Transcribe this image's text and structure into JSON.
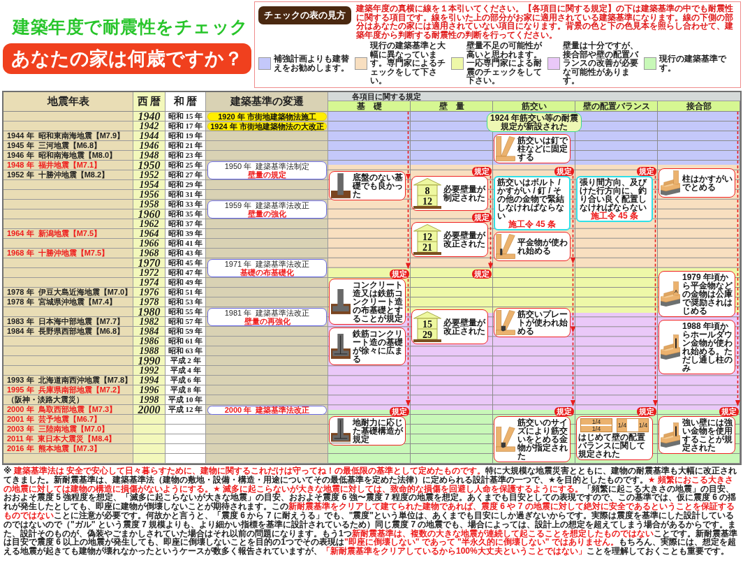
{
  "header": {
    "title": "建築年度で耐震性をチェック",
    "subtitle": "あなたの家は何歳ですか？"
  },
  "legend": {
    "heading": "チェックの表の見方",
    "instructions": "建築年度の真横に線を１本引いてください。【各項目に関する規定】の下は建築基準の中でも耐震性に関する項目です。線を引いた上の部分がお家に適用されている建築基準になります。線の下側の部分はあなたの家には適用されていない項目になります。背景の色と下の色見本を照らし合わせて、建築年度から判断する耐震性の判断を行ってください。",
    "items": [
      {
        "color": "#c4c8fa",
        "text": "補強計画よりも建替えをお勧めします。"
      },
      {
        "color": "#f8dfc0",
        "text": "現行の建築基準と大幅に異なっています。専門家によるチェックをして下さい。"
      },
      {
        "color": "#eef8a8",
        "text": "壁量不足の可能性が高いと思われます。一応専門家による耐震のチェックをして下さい。"
      },
      {
        "color": "#eac8f8",
        "text": "壁量は十分ですが、接合部や壁の配置バランスの改善が必要な可能性があります。"
      },
      {
        "color": "#c8f8b8",
        "text": "現行の建築基準です。"
      }
    ]
  },
  "table": {
    "headers": {
      "events": "地震年表",
      "western": "西 暦",
      "japanese": "和 暦",
      "standards": "建築基準の変遷"
    },
    "rows": [
      {
        "year": "1940",
        "decade": true,
        "era": "昭和 15 年"
      },
      {
        "year": "1942",
        "decade": false,
        "era": "昭和 17 年"
      },
      {
        "event": "1944 年  昭和東南海地震【M7.9】",
        "highlighted": false,
        "year": "1944",
        "decade": false,
        "era": "昭和 19 年"
      },
      {
        "event": "1945 年  三河地震【M6.8】",
        "highlighted": false,
        "year": "1946",
        "decade": false,
        "era": "昭和 21 年"
      },
      {
        "event": "1946 年  昭和南海地震【M8.0】",
        "highlighted": false,
        "year": "1948",
        "decade": false,
        "era": "昭和 23 年"
      },
      {
        "event": "1948 年  福井地震【M7.1】",
        "highlighted": true,
        "year": "1950",
        "decade": true,
        "era": "昭和 25 年"
      },
      {
        "event": "1952 年  十勝沖地震【M8.2】",
        "highlighted": false,
        "year": "1952",
        "decade": false,
        "era": "昭和 27 年"
      },
      {
        "year": "1954",
        "decade": false,
        "era": "昭和 29 年"
      },
      {
        "year": "1956",
        "decade": false,
        "era": "昭和 31 年"
      },
      {
        "year": "1958",
        "decade": false,
        "era": "昭和 33 年"
      },
      {
        "year": "1960",
        "decade": true,
        "era": "昭和 35 年"
      },
      {
        "year": "1962",
        "decade": false,
        "era": "昭和 37 年"
      },
      {
        "event": "1964 年  新潟地震【M7.5】",
        "highlighted": true,
        "year": "1964",
        "decade": false,
        "era": "昭和 39 年"
      },
      {
        "year": "1966",
        "decade": false,
        "era": "昭和 41 年"
      },
      {
        "event": "1968 年  十勝沖地震【M7.5】",
        "highlighted": true,
        "year": "1968",
        "decade": false,
        "era": "昭和 43 年"
      },
      {
        "year": "1970",
        "decade": true,
        "era": "昭和 45 年"
      },
      {
        "year": "1972",
        "decade": false,
        "era": "昭和 47 年"
      },
      {
        "year": "1974",
        "decade": false,
        "era": "昭和 49 年"
      },
      {
        "event": "1978 年  伊豆大島近海地震【M7.0】",
        "highlighted": false,
        "year": "1976",
        "decade": false,
        "era": "昭和 51 年"
      },
      {
        "event": "1978 年  宮城県沖地震【M7.4】",
        "highlighted": false,
        "year": "1978",
        "decade": false,
        "era": "昭和 53 年"
      },
      {
        "year": "1980",
        "decade": true,
        "era": "昭和 55 年"
      },
      {
        "event": "1983 年  日本海中部地震【M7.7】",
        "highlighted": false,
        "year": "1982",
        "decade": false,
        "era": "昭和 57 年"
      },
      {
        "event": "1984 年  長野県西部地震【M6.8】",
        "highlighted": false,
        "year": "1984",
        "decade": false,
        "era": "昭和 59 年"
      },
      {
        "year": "1986",
        "decade": false,
        "era": "昭和 61 年"
      },
      {
        "year": "1988",
        "decade": false,
        "era": "昭和 63 年"
      },
      {
        "year": "1990",
        "decade": true,
        "era": "平成 2 年"
      },
      {
        "year": "1992",
        "decade": false,
        "era": "平成 4 年"
      },
      {
        "event": "1993 年  北海道南西沖地震【M7.8】",
        "highlighted": false,
        "year": "1994",
        "decade": false,
        "era": "平成 6 年"
      },
      {
        "event": "1995 年  兵庫県南部地震【M7.2】",
        "highlighted": true,
        "year": "1996",
        "decade": false,
        "era": "平成 8 年"
      },
      {
        "event": "（阪神・淡路大震災）",
        "highlighted": false,
        "year": "1998",
        "decade": false,
        "era": "平成 10 年"
      },
      {
        "event": "2000 年  鳥取西部地震【M7.3】",
        "highlighted": true,
        "year": "2000",
        "decade": true,
        "era": "平成 12 年"
      },
      {
        "event": "2001 年  芸予地震【M6.7】",
        "highlighted": true
      },
      {
        "event": "2003 年  三陸南地震【M7.0】",
        "highlighted": true
      },
      {
        "event": "2011 年  東日本大震災【M8.4】",
        "highlighted": true
      },
      {
        "event": "2016 年  熊本地震【M7.3】",
        "highlighted": true
      },
      {}
    ],
    "standards": [
      {
        "kind": "pill",
        "title": "1920 年 市街地建築物法施工"
      },
      {
        "kind": "pill",
        "title": "1924 年 市街地建築物法の大改正"
      },
      {
        "kind": "box",
        "title": "1950 年  建築基準法制定",
        "change": "壁量の規定",
        "highlighted": false
      },
      {
        "kind": "box",
        "title": "1959 年  建築基準法改正",
        "change": "壁量の強化",
        "highlighted": false
      },
      {
        "kind": "box",
        "title": "1971 年  建築基準法改正",
        "change": "基礎の布基礎化",
        "highlighted": false
      },
      {
        "kind": "box",
        "title": "1981 年  建築基準法改正",
        "change": "壁量の再強化",
        "highlighted": false
      },
      {
        "kind": "box",
        "title": "2000 年  建築基準法改正",
        "highlighted": true
      }
    ],
    "regulations": {
      "heading": "各項目に関する規定",
      "zones": [
        {
          "color": "#c4c8fa"
        },
        {
          "color": "#f8dfc0"
        },
        {
          "color": "#eef8a8"
        },
        {
          "color": "#eac8f8"
        },
        {
          "color": "#c8f8b8"
        }
      ],
      "columns": [
        {
          "label": "基　礎",
          "cards": [
            {
              "kind": "footing_post",
              "text": "底盤のない基礎でも良かった"
            },
            {
              "kind": "footing_strip",
              "text": "コンクリート造又は鉄筋コンクリート造の布基礎とすることが規定"
            },
            {
              "kind": "footing_rebar",
              "text": "鉄筋コンクリート造の基礎が徐々に広まる"
            },
            {
              "kind": "footing_wide",
              "text": "地耐力に応じた基礎構造が規定"
            }
          ],
          "badges": [
            "規定",
            "規定"
          ]
        },
        {
          "label": "壁　量",
          "cards": [
            {
              "kind": "house",
              "numbers": [
                "8",
                "12"
              ],
              "text": "必要壁量が制定された"
            },
            {
              "kind": "house",
              "numbers": [
                "12",
                "21"
              ],
              "text": "必要壁量が改正された"
            },
            {
              "kind": "house",
              "numbers": [
                "15",
                "29"
              ],
              "text": "必要壁量が改正された"
            }
          ],
          "badges": [
            "規定",
            "規定",
            "規定"
          ]
        },
        {
          "label": "筋交い",
          "cards": [
            {
              "kind": "headline",
              "text": "1924 年筋交い等の耐震規定が新設された"
            },
            {
              "kind": "brace",
              "text": "筋交いは釘で柱などに固定する"
            },
            {
              "kind": "note",
              "text": "筋交いはボルト / かすがい / 釘 / その他の金物で緊結しなければならない",
              "clause": "施工令 45 条"
            },
            {
              "kind": "brace_flat",
              "text": "平金物が使われ始める"
            },
            {
              "kind": "brace_plate",
              "text": "筋交いプレートが使われ始める"
            },
            {
              "kind": "brace_plate",
              "text": "筋交いのサイズにより筋交いをとめる金物が指定された"
            }
          ],
          "badges": [
            "規定",
            "規定"
          ]
        },
        {
          "label": "壁の配置バランス",
          "cards": [
            {
              "kind": "note",
              "text": "張り間方向、及びけた行方向に、釣り合い良く配置しなければならない",
              "clause": "施工令 45 条"
            },
            {
              "kind": "balance",
              "quarters": [
                "1/4",
                "1/4",
                "1/4",
                "1/4"
              ],
              "text": "はじめて壁の配置バランスに関して規定された"
            }
          ],
          "badges": [
            "規定",
            "規定"
          ]
        },
        {
          "label": "接合部",
          "cards": [
            {
              "kind": "joint",
              "text": "柱はかすがいでとめる"
            },
            {
              "kind": "joint_plate",
              "text": "1979 年頃から平金物などの金物は公庫で奨励されはじめる"
            },
            {
              "kind": "joint_holddown",
              "text": "1988 年頃からホールダウン金物が使われ始める。ただし通し柱のみ"
            },
            {
              "kind": "joint_holddown",
              "text": "強い壁には強い金物を使用することが規定された"
            }
          ],
          "badges": [
            "規定"
          ]
        }
      ]
    }
  },
  "footnote": {
    "segments": [
      {
        "text": "※ ",
        "highlighted": false
      },
      {
        "text": "建築基準法は 安全で安心して日々暮らすために、建物に関するこれだけは守ってね！の最低限の基準として定めたものです。",
        "highlighted": true
      },
      {
        "text": "特に大規模な地震災害とともに、建物の耐震基準も大幅に改正されてきました。新耐震基準は、建築基準法（建物の敷地・設備・構造・用途についてその最低基準を定めた法律）に定められる設計基準の一つで、★を目的としたものです。",
        "highlighted": false
      },
      {
        "text": "★ 頻繁におこる大きさの地震に対しては建物の構造に損傷がないようにする。★ 滅多に起こらないが大きな地震に対しては、致命的な損傷を回避し人命を保護するようにする。",
        "highlighted": true
      },
      {
        "text": "「頻繁に起こる大きさの地震」の目安、おおよそ震度 5 強程度を想定、「滅多に起こらないが大きな地震」の目安、おおよそ震度 6 強〜震度 7 程度の地震を想定。あくまでも目安としての表現ですので、この基準では、仮に震度 6 の揺れが発生したとしても、即座に建物が倒壊しないことが期待されます。この",
        "highlighted": false
      },
      {
        "text": "新耐震基準をクリアして建てられた建物であれば、震度 6 や 7 の地震に対して絶対に安全であるということを保証するものではない",
        "highlighted": true
      },
      {
        "text": "ことに注意が必要です。何故かと言うと、「震度 6 から 7 に耐えうる」でも、\"震度\"という単位は、あくまでも目安にしか過ぎないからです。実際は震度を基準にした設計しているのではないので（\"ガル\" という震度 7 規模よりも、より細かい指標を基準に設計されているため）同じ震度 7 の地震でも、場合によっては、設計上の想定を超えてしまう場合があるからです。また、設計そのものが、偽装やごまかしされていた場合はそれ以前の問題になります。もう1つ",
        "highlighted": false
      },
      {
        "text": "新耐震基準は、複数の大きな地震が連続して起こることを想定したものではない",
        "highlighted": true
      },
      {
        "text": "ことです。新耐震基準は目安で震度 6 以上の地震が発生しても、即座に倒壊しないことを目的の1つでその表現は",
        "highlighted": false
      },
      {
        "text": "\"即座に倒壊しない\" であって \"半永久的に倒壊しない\" ではありません。",
        "highlighted": true
      },
      {
        "text": "もちろん、実際には、想定を超える地震が起きても建物が壊れなかったというケースが数多く報告されていますが、",
        "highlighted": false
      },
      {
        "text": "「新耐震基準をクリアしているから100%大丈夫ということではない」",
        "highlighted": true
      },
      {
        "text": "ことを理解しておくことも重要です。",
        "highlighted": false
      }
    ]
  }
}
